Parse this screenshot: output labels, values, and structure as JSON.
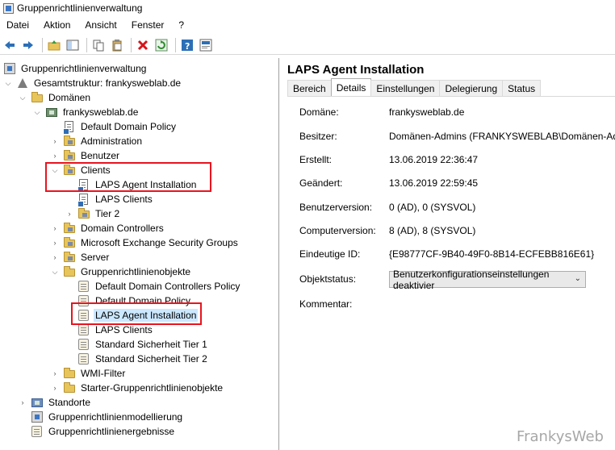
{
  "window": {
    "title": "Gruppenrichtlinienverwaltung"
  },
  "menu": [
    "Datei",
    "Aktion",
    "Ansicht",
    "Fenster",
    "?"
  ],
  "toolbar_icons": [
    "back-arrow-icon",
    "forward-arrow-icon",
    "folder-up-icon",
    "show-hide-tree-icon",
    "copy-icon",
    "paste-icon",
    "delete-icon",
    "refresh-icon",
    "help-icon",
    "properties-icon"
  ],
  "tree": {
    "root": "Gruppenrichtlinienverwaltung",
    "forest": "Gesamtstruktur: frankysweblab.de",
    "domains": "Domänen",
    "domain": "frankysweblab.de",
    "items": {
      "default_domain_policy": "Default Domain Policy",
      "administration": "Administration",
      "benutzer": "Benutzer",
      "clients": "Clients",
      "clients_laps_agent": "LAPS Agent Installation",
      "clients_laps_clients": "LAPS Clients",
      "tier2": "Tier 2",
      "domain_controllers": "Domain Controllers",
      "exchange_groups": "Microsoft Exchange Security Groups",
      "server": "Server",
      "gpo_container": "Gruppenrichtlinienobjekte",
      "gpo_default_dc_policy": "Default Domain Controllers Policy",
      "gpo_default_domain_policy": "Default Domain Policy",
      "gpo_laps_agent": "LAPS Agent Installation",
      "gpo_laps_clients": "LAPS Clients",
      "gpo_std_tier1": "Standard Sicherheit Tier 1",
      "gpo_std_tier2": "Standard Sicherheit Tier 2",
      "wmi_filter": "WMI-Filter",
      "starter_gpo": "Starter-Gruppenrichtlinienobjekte",
      "standorte": "Standorte",
      "modellierung": "Gruppenrichtlinienmodellierung",
      "ergebnisse": "Gruppenrichtlinienergebnisse"
    }
  },
  "detail": {
    "title": "LAPS Agent Installation",
    "tabs": [
      "Bereich",
      "Details",
      "Einstellungen",
      "Delegierung",
      "Status"
    ],
    "active_tab": "Details",
    "properties": {
      "domain_label": "Domäne:",
      "domain_value": "frankysweblab.de",
      "owner_label": "Besitzer:",
      "owner_value": "Domänen-Admins (FRANKYSWEBLAB\\Domänen-Admins)",
      "created_label": "Erstellt:",
      "created_value": "13.06.2019 22:36:47",
      "modified_label": "Geändert:",
      "modified_value": "13.06.2019 22:59:45",
      "user_version_label": "Benutzerversion:",
      "user_version_value": "0 (AD), 0 (SYSVOL)",
      "computer_version_label": "Computerversion:",
      "computer_version_value": "8 (AD), 8 (SYSVOL)",
      "unique_id_label": "Eindeutige ID:",
      "unique_id_value": "{E98777CF-9B40-49F0-8B14-ECFEBB816E61}",
      "status_label": "Objektstatus:",
      "status_value": "Benutzerkonfigurationseinstellungen deaktivier",
      "comment_label": "Kommentar:"
    }
  },
  "watermark": "FrankysWeb",
  "colors": {
    "highlight": "#e8141f",
    "selection": "#cce8ff",
    "folder": "#e8c55a"
  }
}
